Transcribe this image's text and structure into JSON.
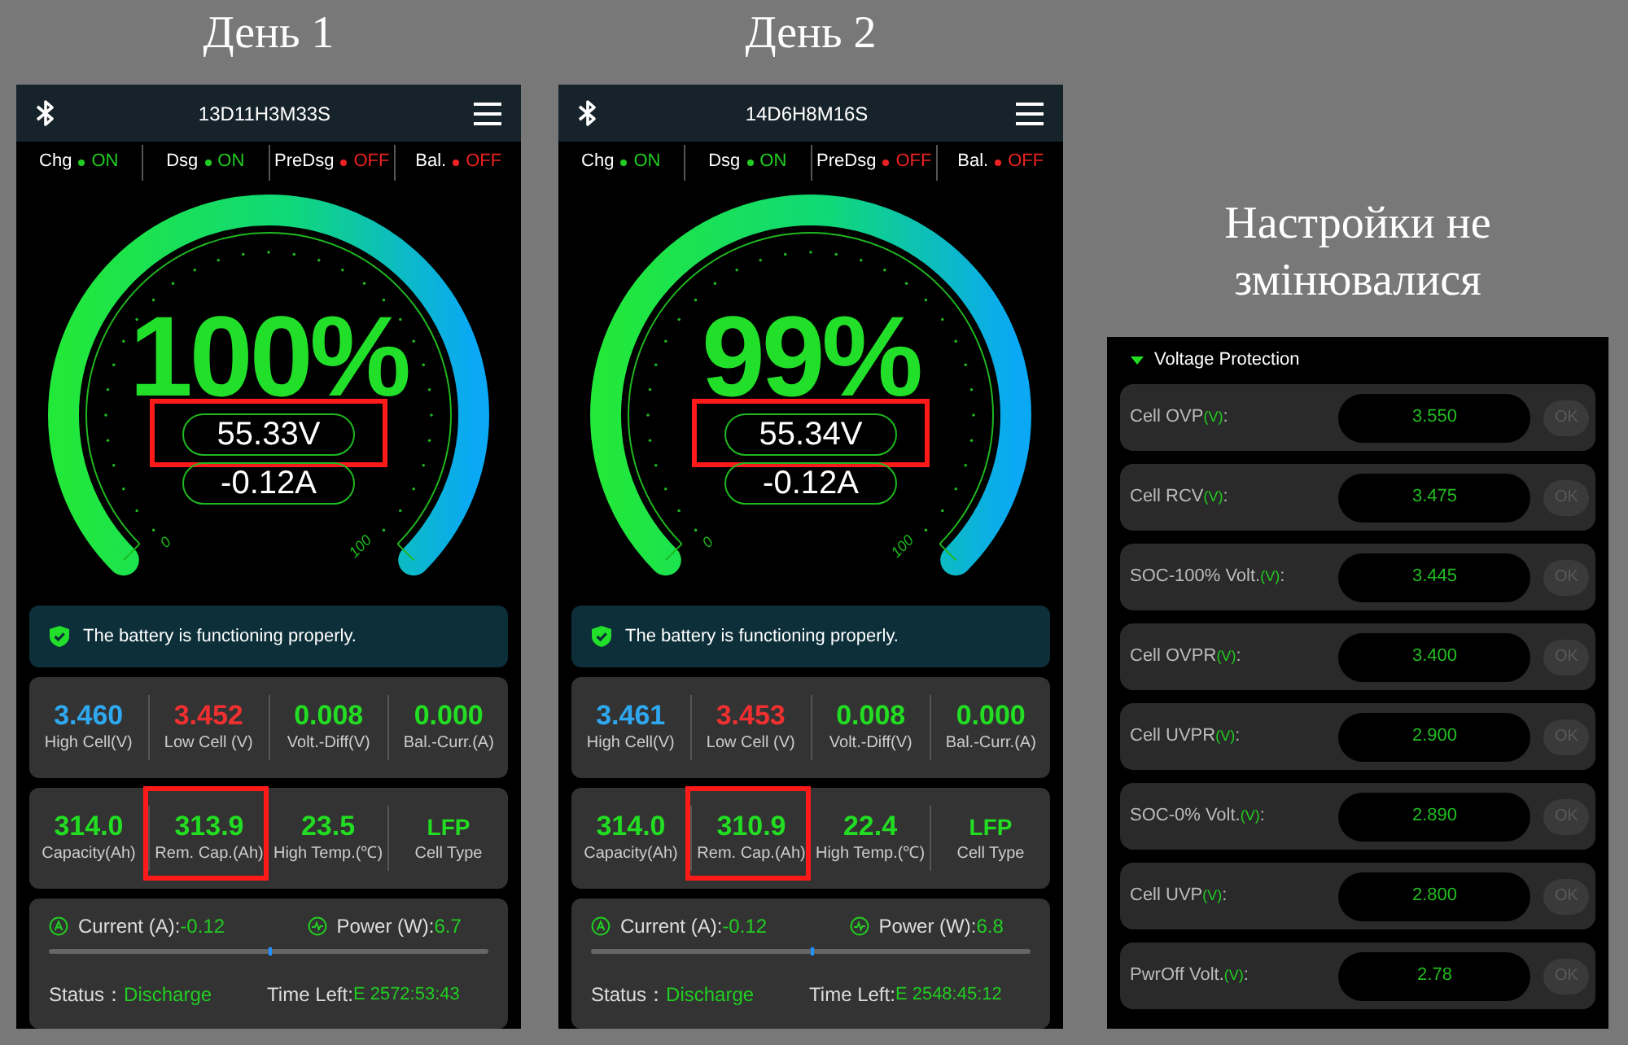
{
  "days": [
    {
      "heading": "День 1",
      "app": {
        "title": "13D11H3M33S",
        "switches": [
          {
            "label": "Chg",
            "value": "ON",
            "on": true
          },
          {
            "label": "Dsg",
            "value": "ON",
            "on": true
          },
          {
            "label": "PreDsg",
            "value": "OFF",
            "on": false
          },
          {
            "label": "Bal.",
            "value": "OFF",
            "on": false
          }
        ],
        "gauge": {
          "percent": "100%",
          "scale_min": "0",
          "scale_max": "100",
          "voltage": {
            "value": "55.33V",
            "highlighted": true
          },
          "current": {
            "value": "-0.12A"
          }
        },
        "alert": "The battery is functioning properly.",
        "cell_stats": [
          {
            "value": "3.460",
            "label": "High Cell(V)",
            "color": "#2ea8f0"
          },
          {
            "value": "3.452",
            "label": "Low Cell (V)",
            "color": "#f03030"
          },
          {
            "value": "0.008",
            "label": "Volt.-Diff(V)",
            "color": "#22dd22"
          },
          {
            "value": "0.000",
            "label": "Bal.-Curr.(A)",
            "color": "#22dd22"
          }
        ],
        "pack_stats": [
          {
            "value": "314.0",
            "label": "Capacity(Ah)",
            "highlighted": false
          },
          {
            "value": "313.9",
            "label": "Rem. Cap.(Ah)",
            "highlighted": true
          },
          {
            "value": "23.5",
            "label": "High Temp.(℃)",
            "highlighted": false
          },
          {
            "value": "LFP",
            "label": "Cell Type",
            "highlighted": false
          }
        ],
        "flow": {
          "current_label": "Current (A):",
          "current": "-0.12",
          "power_label": "Power (W):",
          "power": "6.7",
          "level": 0.5,
          "status_label": "Status：",
          "status": "Discharge",
          "time_label": "Time Left:",
          "time_left": "E 2572:53:43"
        }
      }
    },
    {
      "heading": "День 2",
      "app": {
        "title": "14D6H8M16S",
        "switches": [
          {
            "label": "Chg",
            "value": "ON",
            "on": true
          },
          {
            "label": "Dsg",
            "value": "ON",
            "on": true
          },
          {
            "label": "PreDsg",
            "value": "OFF",
            "on": false
          },
          {
            "label": "Bal.",
            "value": "OFF",
            "on": false
          }
        ],
        "gauge": {
          "percent": "99%",
          "scale_min": "0",
          "scale_max": "100",
          "voltage": {
            "value": "55.34V",
            "highlighted": true
          },
          "current": {
            "value": "-0.12A"
          }
        },
        "alert": "The battery is functioning properly.",
        "cell_stats": [
          {
            "value": "3.461",
            "label": "High Cell(V)",
            "color": "#2ea8f0"
          },
          {
            "value": "3.453",
            "label": "Low Cell (V)",
            "color": "#f03030"
          },
          {
            "value": "0.008",
            "label": "Volt.-Diff(V)",
            "color": "#22dd22"
          },
          {
            "value": "0.000",
            "label": "Bal.-Curr.(A)",
            "color": "#22dd22"
          }
        ],
        "pack_stats": [
          {
            "value": "314.0",
            "label": "Capacity(Ah)",
            "highlighted": false
          },
          {
            "value": "310.9",
            "label": "Rem. Cap.(Ah)",
            "highlighted": true
          },
          {
            "value": "22.4",
            "label": "High Temp.(℃)",
            "highlighted": false
          },
          {
            "value": "LFP",
            "label": "Cell Type",
            "highlighted": false
          }
        ],
        "flow": {
          "current_label": "Current (A):",
          "current": "-0.12",
          "power_label": "Power (W):",
          "power": "6.8",
          "level": 0.5,
          "status_label": "Status：",
          "status": "Discharge",
          "time_label": "Time Left:",
          "time_left": "E 2548:45:12"
        }
      }
    }
  ],
  "settings": {
    "heading": "Настройки не змінювалися",
    "section": {
      "title": "Voltage Protection",
      "expanded": true
    },
    "rows": [
      {
        "label": "Cell OVP",
        "unit": "(V)",
        "separator": ":",
        "value": "3.550",
        "button": "OK",
        "disabled": true
      },
      {
        "label": "Cell RCV",
        "unit": "(V)",
        "separator": ":",
        "value": "3.475",
        "button": "OK",
        "disabled": true
      },
      {
        "label": "SOC-100% Volt.",
        "unit": "(V)",
        "separator": ":",
        "value": "3.445",
        "button": "OK",
        "disabled": true
      },
      {
        "label": "Cell OVPR",
        "unit": "(V)",
        "separator": ":",
        "value": "3.400",
        "button": "OK",
        "disabled": true
      },
      {
        "label": "Cell UVPR",
        "unit": "(V)",
        "separator": ":",
        "value": "2.900",
        "button": "OK",
        "disabled": true
      },
      {
        "label": "SOC-0% Volt.",
        "unit": "(V)",
        "separator": ":",
        "value": "2.890",
        "button": "OK",
        "disabled": true
      },
      {
        "label": "Cell UVP",
        "unit": "(V)",
        "separator": ":",
        "value": "2.800",
        "button": "OK",
        "disabled": true
      },
      {
        "label": "PwrOff Volt.",
        "unit": "(V)",
        "separator": ":",
        "value": "2.78",
        "button": "OK",
        "disabled": true
      }
    ]
  }
}
